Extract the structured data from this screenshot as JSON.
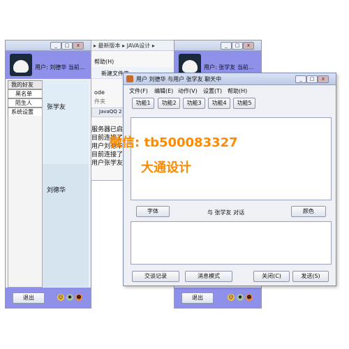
{
  "login_window": {
    "user_label": "用户: 刘德华 当前...",
    "tabs": [
      "我的好友",
      "黑名单",
      "陌生人",
      "系统设置"
    ],
    "friends": [
      "张学友",
      "刘德华"
    ],
    "exit_label": "退出"
  },
  "ide_window": {
    "breadcrumb": "▸ 最新版本 ▸ JAVA设计 ▸",
    "menu_help": "帮助(H)",
    "new_folder": "新建文件夹",
    "col_name": "ode",
    "file_folder": "件夹",
    "tab_label": "JavaQQ 2",
    "console_lines": [
      "服务器已启",
      "目前连接了",
      "用户刘德华",
      "目前连接了",
      "用户张学友"
    ]
  },
  "second_login": {
    "user_label": "用户: 张学友 当前...",
    "exit_label": "退出"
  },
  "chat_window": {
    "title": "用户 刘德华 与用户 张学友 聊天中",
    "menu": [
      "文件(F)",
      "编辑(E)",
      "动作(V)",
      "设置(T)",
      "帮助(H)"
    ],
    "func_buttons": [
      "功能1",
      "功能2",
      "功能3",
      "功能4",
      "功能5"
    ],
    "font_button": "字体",
    "conversation_label": "与 张学友 对话",
    "color_button": "颜色",
    "history_button": "交谈记录",
    "message_mode_button": "消息模式",
    "close_button": "关闭(C)",
    "send_button": "发送(S)"
  },
  "watermark": {
    "line1": "微信: tb500083327",
    "line2": "大通设计",
    "color": "#ff8a00"
  },
  "colors": {
    "accent": "#8f90ea",
    "friend_list": "#d6e4f0"
  }
}
